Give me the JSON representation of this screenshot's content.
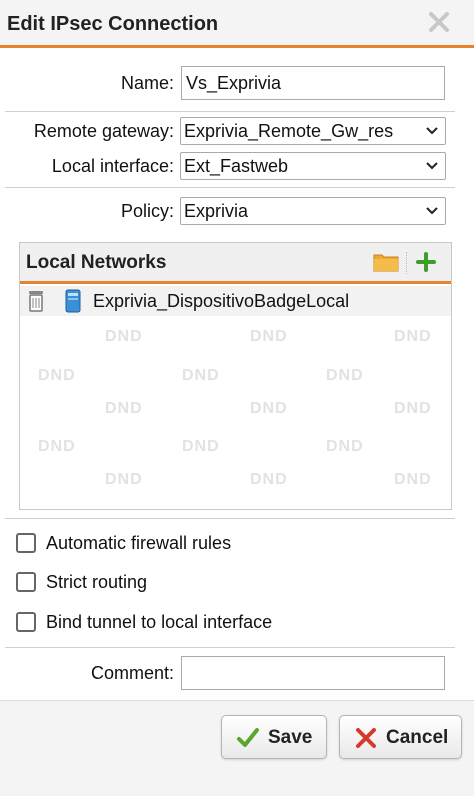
{
  "dialog": {
    "title": "Edit IPsec Connection",
    "close_icon": "close-icon"
  },
  "form": {
    "name_label": "Name:",
    "name_value": "Vs_Exprivia",
    "remote_gateway_label": "Remote gateway:",
    "remote_gateway_value": "Exprivia_Remote_Gw_res",
    "local_interface_label": "Local interface:",
    "local_interface_value": "Ext_Fastweb",
    "policy_label": "Policy:",
    "policy_value": "Exprivia",
    "comment_label": "Comment:",
    "comment_value": ""
  },
  "local_networks": {
    "title": "Local Networks",
    "items": [
      {
        "label": "Exprivia_DispositivoBadgeLocal",
        "icon": "network-host-icon"
      }
    ],
    "dnd_text": "DND"
  },
  "options": [
    {
      "label": "Automatic firewall rules",
      "checked": false
    },
    {
      "label": "Strict routing",
      "checked": false
    },
    {
      "label": "Bind tunnel to local interface",
      "checked": false
    }
  ],
  "buttons": {
    "save_label": "Save",
    "cancel_label": "Cancel"
  },
  "colors": {
    "accent": "#e8842d",
    "save_check": "#5aa52b",
    "cancel_x": "#d43a2a",
    "folder": "#f0a830",
    "plus": "#3f9e2a"
  }
}
